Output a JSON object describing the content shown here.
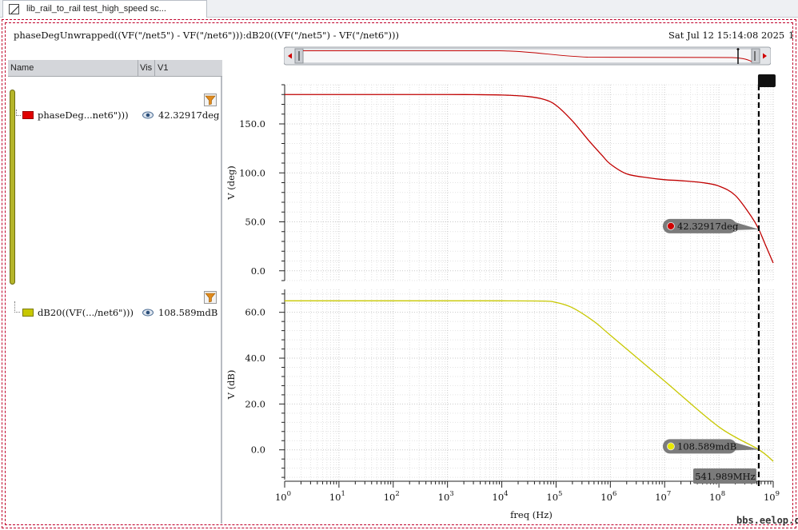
{
  "window": {
    "tab_title": "lib_rail_to_rail test_high_speed sc...",
    "expression": "phaseDegUnwrapped((VF(\"/net5\") - VF(\"/net6\"))):dB20((VF(\"/net5\") - VF(\"/net6\")))",
    "timestamp": "Sat Jul 12 15:14:08 2025",
    "corner_label": "1"
  },
  "trace_panel": {
    "col_name": "Name",
    "col_vis": "Vis",
    "col_v1": "V1",
    "traces": [
      {
        "name": "phaseDeg...net6\")))",
        "value": "42.32917deg",
        "color": "#e00000"
      },
      {
        "name": "dB20((VF(.../net6\")))",
        "value": "108.589mdB",
        "color": "#c8c800"
      }
    ]
  },
  "watermark": "bbs.eelop.cn",
  "chart_data": [
    {
      "type": "line",
      "ylabel": "V (deg)",
      "xscale": "log",
      "xlim": [
        1,
        1000000000
      ],
      "ylim": [
        -10,
        190
      ],
      "yticks": [
        "0.0",
        "50.0",
        "100.0",
        "150.0"
      ],
      "grid": true,
      "series": [
        {
          "color": "#c00000",
          "x": [
            1,
            10,
            100,
            1000,
            3000,
            10000,
            30000,
            60000,
            100000,
            200000,
            400000,
            700000,
            1000000,
            2000000,
            5000000,
            10000000,
            20000000,
            50000000,
            100000000,
            200000000,
            400000000,
            541989000,
            700000000,
            1000000000
          ],
          "y": [
            180,
            180,
            180,
            180,
            179.9,
            179.5,
            178,
            175,
            169,
            153,
            133,
            118,
            109,
            99,
            95,
            93,
            92,
            90,
            86.5,
            77,
            55,
            42.32917,
            28,
            8
          ]
        }
      ],
      "marker": {
        "label": "42.32917deg",
        "x": 541989000,
        "y": 42.32917,
        "color": "#d00000"
      }
    },
    {
      "type": "line",
      "ylabel": "V (dB)",
      "xlabel": "freq (Hz)",
      "xscale": "log",
      "xlim": [
        1,
        1000000000
      ],
      "ylim": [
        -13,
        70
      ],
      "yticks": [
        "0.0",
        "20.0",
        "40.0",
        "60.0"
      ],
      "xticks": [
        "0",
        "1",
        "2",
        "3",
        "4",
        "5",
        "6",
        "7",
        "8",
        "9"
      ],
      "grid": true,
      "series": [
        {
          "color": "#c8c800",
          "x": [
            1,
            10,
            100,
            1000,
            10000,
            60000,
            100000,
            200000,
            500000,
            1000000,
            10000000,
            100000000,
            541989000,
            1000000000
          ],
          "y": [
            65,
            65,
            65,
            65,
            65,
            64.9,
            64.3,
            62,
            56,
            50,
            30,
            10,
            0.108589,
            -5
          ]
        }
      ],
      "marker": {
        "label": "108.589mdB",
        "x": 541989000,
        "y": 0.108589,
        "color": "#e8e800"
      }
    }
  ],
  "cursor": {
    "label": "V1",
    "x": 541989000,
    "freq_label": "541.989MHz"
  }
}
